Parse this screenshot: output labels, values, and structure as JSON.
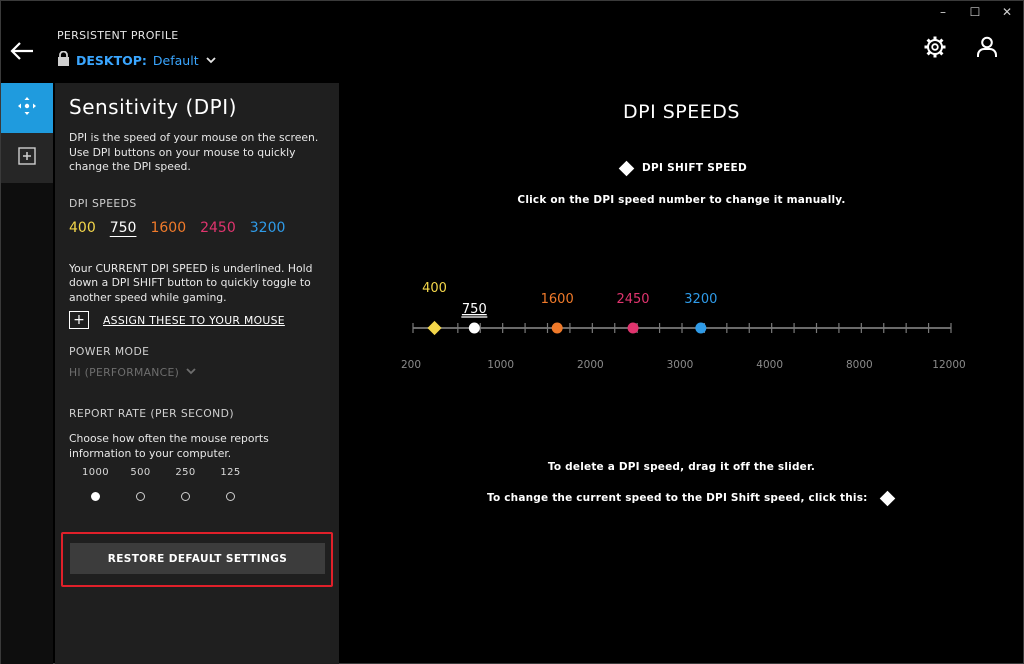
{
  "window": {
    "minimize": "–",
    "maximize": "☐",
    "close": "✕"
  },
  "header": {
    "profile_label": "PERSISTENT PROFILE",
    "desktop_label": "DESKTOP:",
    "profile_name": "Default"
  },
  "panel": {
    "title": "Sensitivity (DPI)",
    "description": "DPI is the speed of your mouse on the screen. Use DPI buttons on your mouse to quickly change the DPI speed.",
    "dpi_speeds_label": "DPI SPEEDS",
    "speeds": [
      {
        "value": "400",
        "color": "#f3d64a"
      },
      {
        "value": "750",
        "color": "#ffffff"
      },
      {
        "value": "1600",
        "color": "#f07a2a"
      },
      {
        "value": "2450",
        "color": "#e0346e"
      },
      {
        "value": "3200",
        "color": "#2f9be8"
      }
    ],
    "current_info": "Your CURRENT DPI SPEED is underlined. Hold down a DPI SHIFT button to quickly toggle to another speed while gaming.",
    "assign_label": "ASSIGN THESE TO YOUR MOUSE",
    "power_mode_label": "POWER MODE",
    "power_mode_value": "HI (PERFORMANCE)",
    "report_rate_label": "REPORT RATE (PER SECOND)",
    "report_rate_desc": "Choose how often the mouse reports information to your computer.",
    "report_rates": [
      {
        "value": "1000",
        "selected": true
      },
      {
        "value": "500",
        "selected": false
      },
      {
        "value": "250",
        "selected": false
      },
      {
        "value": "125",
        "selected": false
      }
    ],
    "restore_label": "RESTORE DEFAULT SETTINGS"
  },
  "main": {
    "title": "DPI SPEEDS",
    "shift_label": "DPI SHIFT SPEED",
    "hint_manual": "Click on the DPI speed number to change it manually.",
    "scale_labels": [
      "200",
      "1000",
      "2000",
      "3000",
      "4000",
      "8000",
      "12000"
    ],
    "markers": [
      {
        "value": "400",
        "color": "#f3d64a",
        "shape": "diamond",
        "pos": 0.04
      },
      {
        "value": "750",
        "color": "#ffffff",
        "shape": "circle",
        "pos": 0.114,
        "current": true
      },
      {
        "value": "1600",
        "color": "#f07a2a",
        "shape": "circle",
        "pos": 0.268
      },
      {
        "value": "2450",
        "color": "#e0346e",
        "shape": "circle",
        "pos": 0.409
      },
      {
        "value": "3200",
        "color": "#2f9be8",
        "shape": "circle",
        "pos": 0.535
      }
    ],
    "hint_delete": "To delete a DPI speed, drag it off the slider.",
    "hint_shift": "To change the current speed to the DPI Shift speed, click this:"
  }
}
